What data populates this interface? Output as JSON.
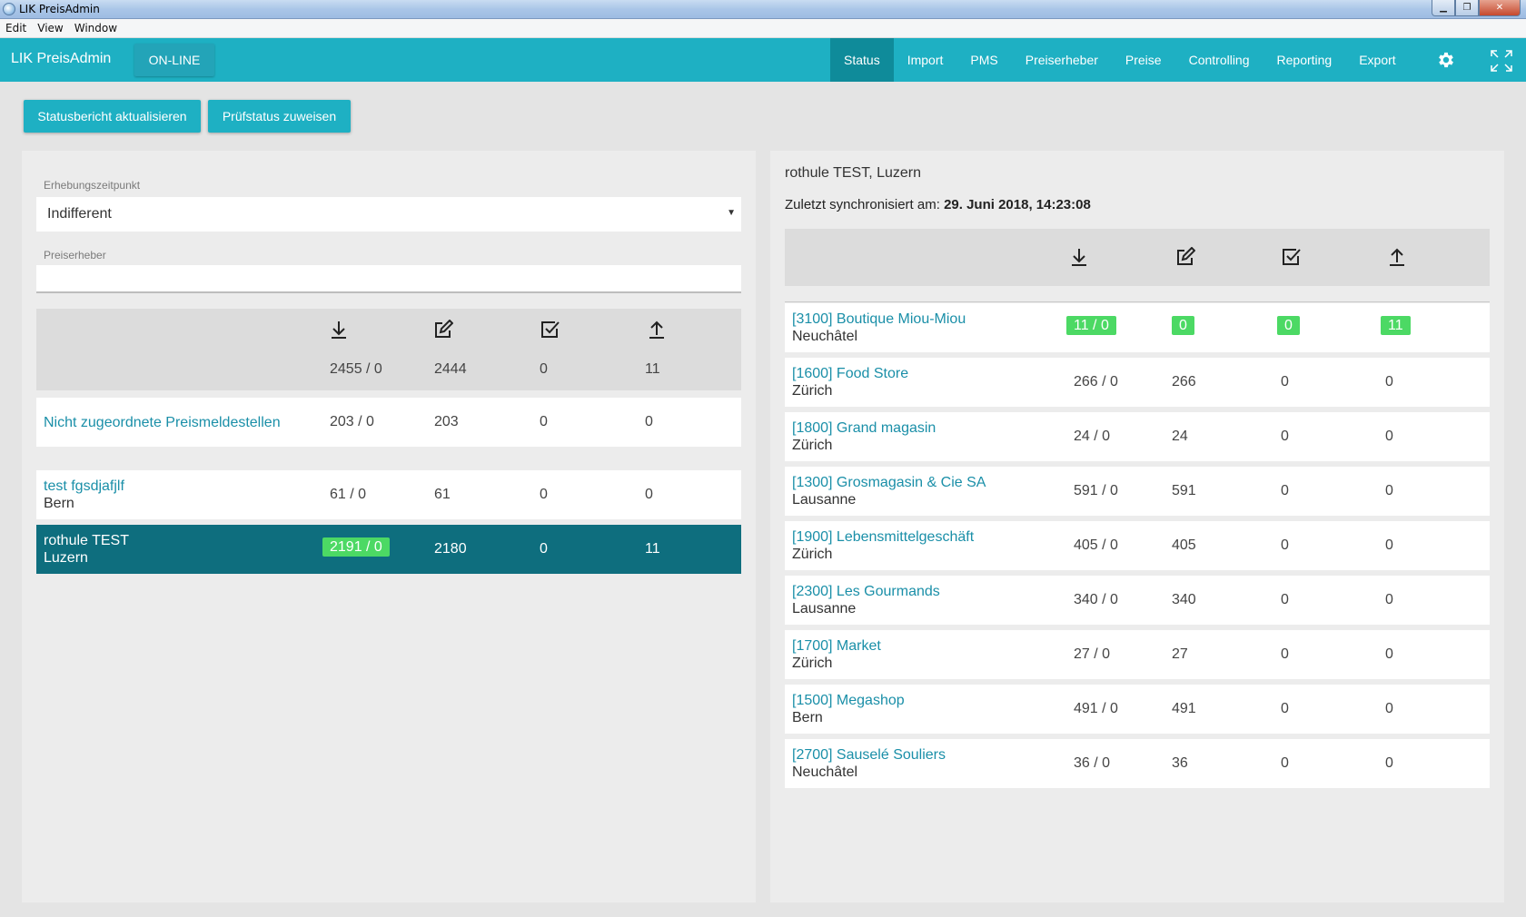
{
  "window": {
    "title": "LIK PreisAdmin",
    "menu": [
      "Edit",
      "View",
      "Window"
    ]
  },
  "header": {
    "brand": "LIK PreisAdmin",
    "status_button": "ON-LINE",
    "tabs": [
      {
        "label": "Status",
        "active": true
      },
      {
        "label": "Import"
      },
      {
        "label": "PMS"
      },
      {
        "label": "Preiserheber"
      },
      {
        "label": "Preise"
      },
      {
        "label": "Controlling"
      },
      {
        "label": "Reporting"
      },
      {
        "label": "Export"
      }
    ],
    "icons": [
      "gear-icon",
      "expand-icon"
    ],
    "color": "#1eb0c3",
    "active_color": "#0f8b9a"
  },
  "actions": {
    "refresh_label": "Statusbericht aktualisieren",
    "assign_label": "Prüfstatus zuweisen"
  },
  "left": {
    "filter_time_label": "Erhebungszeitpunkt",
    "filter_time_value": "Indifferent",
    "filter_collector_label": "Preiserheber",
    "filter_collector_value": "",
    "column_icons": [
      "download-icon",
      "edit-icon",
      "checked-icon",
      "upload-icon"
    ],
    "totals": [
      "2455 / 0",
      "2444",
      "0",
      "11"
    ],
    "unassigned": {
      "name": "Nicht zugeordnete Preismeldestellen",
      "values": [
        "203 / 0",
        "203",
        "0",
        "0"
      ]
    },
    "collectors": [
      {
        "name": "test fgsdjafjlf",
        "city": "Bern",
        "values": [
          "61 / 0",
          "61",
          "0",
          "0"
        ],
        "selected": false
      },
      {
        "name": "rothule TEST",
        "city": "Luzern",
        "values": [
          "2191 / 0",
          "2180",
          "0",
          "11"
        ],
        "selected": true,
        "highlight": "#4cd964"
      }
    ]
  },
  "right": {
    "title": "rothule TEST, Luzern",
    "sync_label": "Zuletzt synchronisiert am:",
    "sync_value": "29. Juni 2018, 14:23:08",
    "column_icons": [
      "download-icon",
      "edit-icon",
      "checked-icon",
      "upload-icon"
    ],
    "stores": [
      {
        "name": "[3100] Boutique Miou-Miou",
        "city": "Neuchâtel",
        "values": [
          "11 / 0",
          "0",
          "0",
          "11"
        ],
        "highlight": true
      },
      {
        "name": "[1600] Food Store",
        "city": "Zürich",
        "values": [
          "266 / 0",
          "266",
          "0",
          "0"
        ]
      },
      {
        "name": "[1800] Grand magasin",
        "city": "Zürich",
        "values": [
          "24 / 0",
          "24",
          "0",
          "0"
        ]
      },
      {
        "name": "[1300] Grosmagasin & Cie SA",
        "city": "Lausanne",
        "values": [
          "591 / 0",
          "591",
          "0",
          "0"
        ]
      },
      {
        "name": "[1900] Lebensmittelgeschäft",
        "city": "Zürich",
        "values": [
          "405 / 0",
          "405",
          "0",
          "0"
        ]
      },
      {
        "name": "[2300] Les Gourmands",
        "city": "Lausanne",
        "values": [
          "340 / 0",
          "340",
          "0",
          "0"
        ]
      },
      {
        "name": "[1700] Market",
        "city": "Zürich",
        "values": [
          "27 / 0",
          "27",
          "0",
          "0"
        ]
      },
      {
        "name": "[1500] Megashop",
        "city": "Bern",
        "values": [
          "491 / 0",
          "491",
          "0",
          "0"
        ]
      },
      {
        "name": "[2700] Sauselé Souliers",
        "city": "Neuchâtel",
        "values": [
          "36 / 0",
          "36",
          "0",
          "0"
        ]
      }
    ]
  }
}
